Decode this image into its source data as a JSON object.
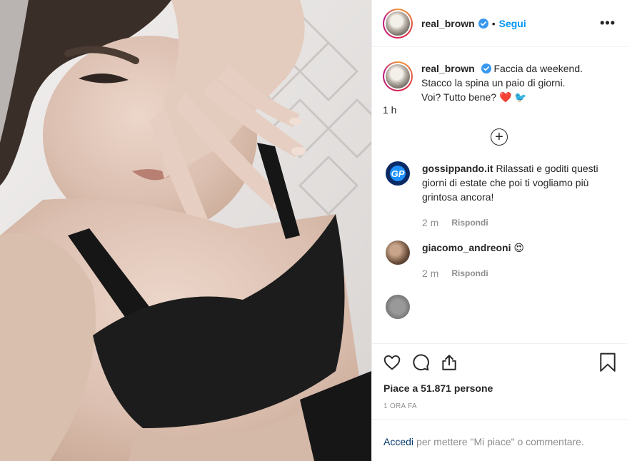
{
  "post": {
    "username": "real_brown",
    "follow_label": "Segui",
    "separator": "•",
    "more_label": "•••",
    "caption": {
      "text_line1": "Faccia da weekend.",
      "text_line2": "Stacco la spina un paio di giorni.",
      "text_line3": "Voi? Tutto bene? ❤️ 🐦",
      "age": "1 h"
    },
    "load_more_label": "+",
    "comments": [
      {
        "username": "gossippando.it",
        "avatar_initials": "GP",
        "text": "Rilassati e goditi questi giorni di estate che poi ti vogliamo più grintosa ancora!",
        "age": "2 m",
        "reply_label": "Rispondi"
      },
      {
        "username": "giacomo_andreoni",
        "text": "😍",
        "age": "2 m",
        "reply_label": "Rispondi"
      }
    ],
    "likes_text": "Piace a 51.871 persone",
    "timestamp": "1 ORA FA",
    "login": {
      "link_label": "Accedi",
      "rest_text": "per mettere \"Mi piace\" o commentare."
    },
    "icons": {
      "like": "heart-icon",
      "comment": "comment-icon",
      "share": "share-icon",
      "save": "bookmark-icon",
      "verified": "verified-badge-icon"
    },
    "colors": {
      "accent": "#0095f6",
      "text": "#262626",
      "muted": "#8e8e8e",
      "link": "#00376b"
    }
  }
}
